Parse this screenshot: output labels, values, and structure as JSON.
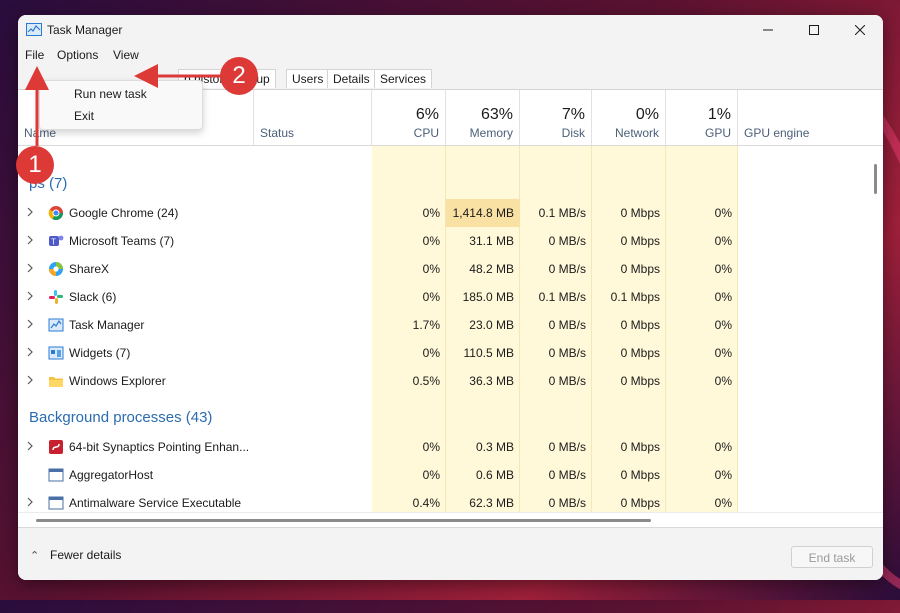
{
  "window": {
    "title": "Task Manager"
  },
  "menu": {
    "items": [
      "File",
      "Options",
      "View"
    ]
  },
  "file_menu": {
    "items": [
      "Run new task",
      "Exit"
    ]
  },
  "tabs": [
    "p history",
    "rtup",
    "Users",
    "Details",
    "Services"
  ],
  "header": {
    "name": "Name",
    "status": "Status",
    "columns": [
      {
        "pct": "6%",
        "label": "CPU"
      },
      {
        "pct": "63%",
        "label": "Memory"
      },
      {
        "pct": "7%",
        "label": "Disk"
      },
      {
        "pct": "0%",
        "label": "Network"
      },
      {
        "pct": "1%",
        "label": "GPU"
      }
    ],
    "gpu_engine": "GPU engine"
  },
  "groups": {
    "apps": "ps (7)",
    "background": "Background processes (43)"
  },
  "apps": [
    {
      "name": "Google Chrome (24)",
      "icon": "chrome-icon",
      "cpu": "0%",
      "memory": "1,414.8 MB",
      "disk": "0.1 MB/s",
      "network": "0 Mbps",
      "gpu": "0%"
    },
    {
      "name": "Microsoft Teams (7)",
      "icon": "teams-icon",
      "cpu": "0%",
      "memory": "31.1 MB",
      "disk": "0 MB/s",
      "network": "0 Mbps",
      "gpu": "0%"
    },
    {
      "name": "ShareX",
      "icon": "sharex-icon",
      "cpu": "0%",
      "memory": "48.2 MB",
      "disk": "0 MB/s",
      "network": "0 Mbps",
      "gpu": "0%"
    },
    {
      "name": "Slack (6)",
      "icon": "slack-icon",
      "cpu": "0%",
      "memory": "185.0 MB",
      "disk": "0.1 MB/s",
      "network": "0.1 Mbps",
      "gpu": "0%"
    },
    {
      "name": "Task Manager",
      "icon": "task-manager-icon",
      "cpu": "1.7%",
      "memory": "23.0 MB",
      "disk": "0 MB/s",
      "network": "0 Mbps",
      "gpu": "0%"
    },
    {
      "name": "Widgets (7)",
      "icon": "widgets-icon",
      "cpu": "0%",
      "memory": "110.5 MB",
      "disk": "0 MB/s",
      "network": "0 Mbps",
      "gpu": "0%"
    },
    {
      "name": "Windows Explorer",
      "icon": "folder-icon",
      "cpu": "0.5%",
      "memory": "36.3 MB",
      "disk": "0 MB/s",
      "network": "0 Mbps",
      "gpu": "0%"
    }
  ],
  "background": [
    {
      "name": "64-bit Synaptics Pointing Enhan...",
      "icon": "synaptics-icon",
      "cpu": "0%",
      "memory": "0.3 MB",
      "disk": "0 MB/s",
      "network": "0 Mbps",
      "gpu": "0%"
    },
    {
      "name": "AggregatorHost",
      "icon": "service-icon",
      "cpu": "0%",
      "memory": "0.6 MB",
      "disk": "0 MB/s",
      "network": "0 Mbps",
      "gpu": "0%"
    },
    {
      "name": "Antimalware Service Executable",
      "icon": "service-icon",
      "cpu": "0.4%",
      "memory": "62.3 MB",
      "disk": "0 MB/s",
      "network": "0 Mbps",
      "gpu": "0%"
    }
  ],
  "footer": {
    "fewer_details": "Fewer details",
    "end_task": "End task"
  },
  "annotations": [
    "1",
    "2"
  ],
  "colors": {
    "accent": "#2b6cb0",
    "heat_light": "#fff8d9",
    "heat_strong": "#f9e0a3",
    "annotation": "#dd3a37"
  }
}
